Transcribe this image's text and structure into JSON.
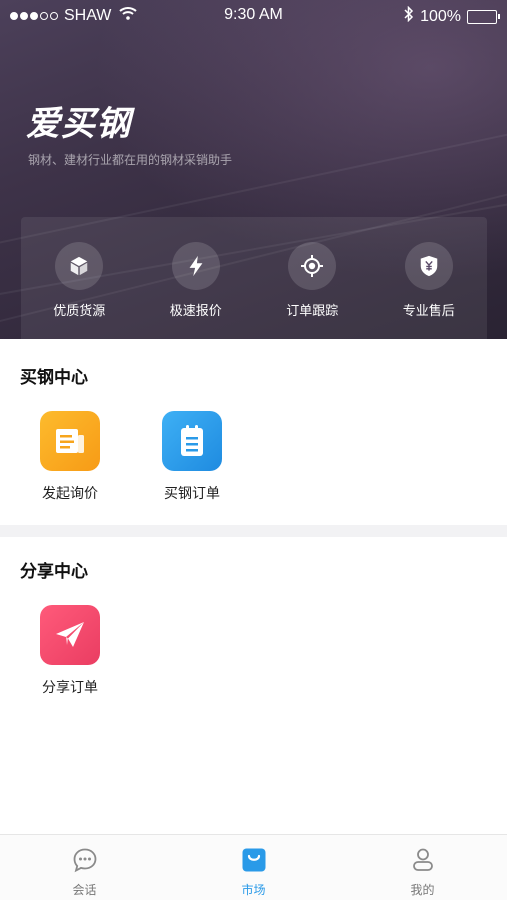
{
  "status_bar": {
    "carrier": "SHAW",
    "time": "9:30 AM",
    "battery": "100%"
  },
  "header": {
    "logo_text": "爱买钢",
    "subtitle": "钢材、建材行业都在用的钢材采销助手"
  },
  "features": [
    {
      "label": "优质货源",
      "icon": "box-icon"
    },
    {
      "label": "极速报价",
      "icon": "lightning-icon"
    },
    {
      "label": "订单跟踪",
      "icon": "target-icon"
    },
    {
      "label": "专业售后",
      "icon": "shield-icon"
    }
  ],
  "buy_center": {
    "title": "买钢中心",
    "items": [
      {
        "label": "发起询价",
        "icon": "inquiry-icon",
        "color": "#f7a51c"
      },
      {
        "label": "买钢订单",
        "icon": "clipboard-icon",
        "color": "#2a9ae8"
      }
    ]
  },
  "share_center": {
    "title": "分享中心",
    "items": [
      {
        "label": "分享订单",
        "icon": "paper-plane-icon",
        "color": "#f0466a"
      }
    ]
  },
  "tabbar": {
    "items": [
      {
        "label": "会话",
        "icon": "chat-icon"
      },
      {
        "label": "市场",
        "icon": "market-bag-icon",
        "active": true
      },
      {
        "label": "我的",
        "icon": "profile-icon"
      }
    ]
  },
  "colors": {
    "accent": "#2a9ae8",
    "hero_bg": "#3e3349"
  }
}
